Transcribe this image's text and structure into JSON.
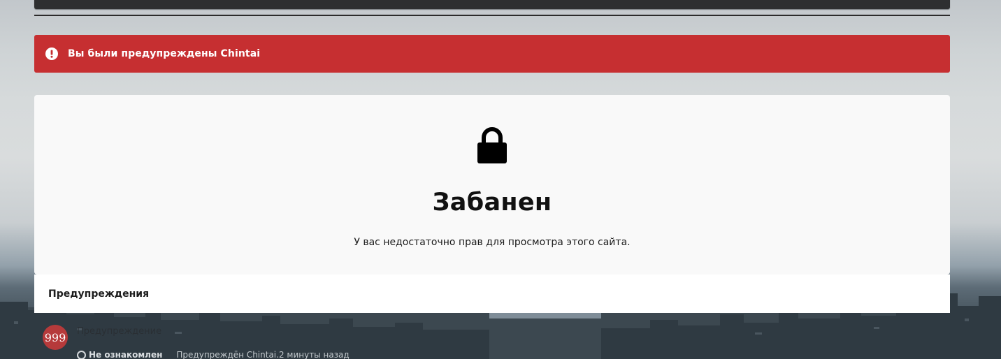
{
  "alert": {
    "text": "Вы были предупреждены Chintai",
    "icon": "exclamation-circle-icon",
    "color": "#c62f31"
  },
  "banned": {
    "icon": "lock-icon",
    "title": "Забанен",
    "description": "У вас недостаточно прав для просмотра этого сайта."
  },
  "warnings": {
    "header": "Предупреждения",
    "items": [
      {
        "avatar_text": "999",
        "avatar_color": "#b63a3b",
        "type": "Предупреждение",
        "status": "Не ознакомлен",
        "meta": "Предупреждён Chintai.2 минуты назад"
      }
    ]
  }
}
